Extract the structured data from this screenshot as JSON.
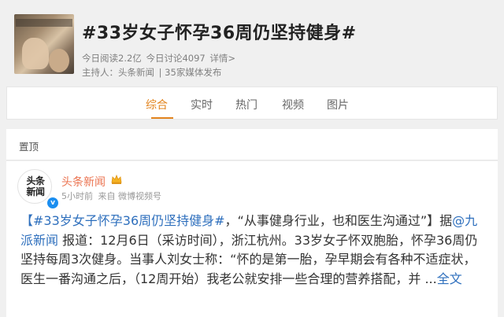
{
  "topic": {
    "title": "#33岁女子怀孕36周仍坚持健身#",
    "reads": "今日阅读2.2亿",
    "discussions": "今日讨论4097",
    "details_link": "详情>",
    "host_label": "主持人：头条新闻",
    "media_count": "| 35家媒体发布"
  },
  "tabs": [
    {
      "label": "综合",
      "active": true
    },
    {
      "label": "实时"
    },
    {
      "label": "热门"
    },
    {
      "label": "视频"
    },
    {
      "label": "图片"
    }
  ],
  "pinned": {
    "label": "置顶"
  },
  "post": {
    "avatar_line1": "头条",
    "avatar_line2": "新闻",
    "author": "头条新闻",
    "time": "5小时前",
    "source": "来自 微博视频号",
    "body": {
      "hashtag": "【#33岁女子怀孕36周仍坚持健身#",
      "quote": "，“从事健身行业，也和医生沟通过”】据",
      "mention": "@九派新闻",
      "line_a": " 报道：12月6日（采访时间），浙江杭州。33岁女子怀双胞胎，怀孕36周仍坚持每周3次健身。当事人刘女士称：“怀的是第一胎，孕早期会有各种不适症状，医生一番沟通之后，（12周开始）我老公就安排一些合理的营养搭配，并 ...",
      "full_text_link": "全文"
    }
  },
  "colors": {
    "accent": "#e2841e",
    "author": "#eb7350",
    "link": "#2e6fbd",
    "verify": "#1b8ef0"
  }
}
